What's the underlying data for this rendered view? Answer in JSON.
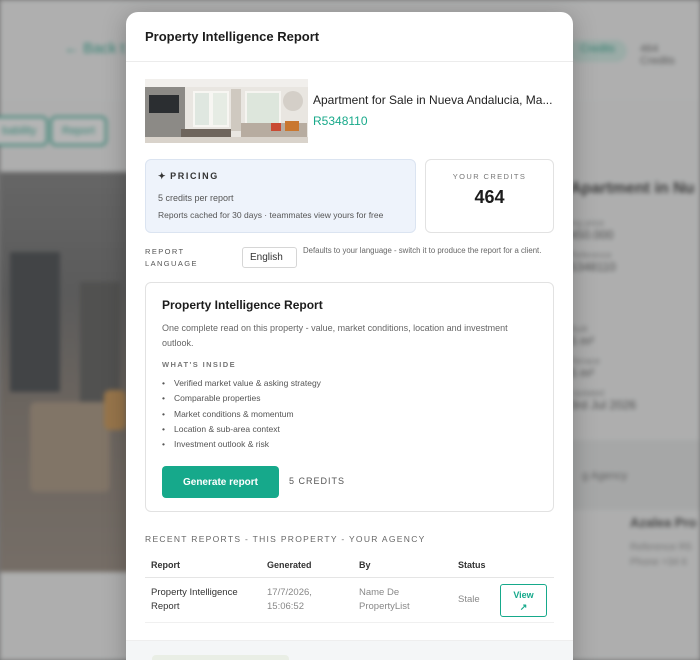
{
  "background": {
    "back_link": "← Back t",
    "credits_chip": "Credits",
    "credits_count": "464 Credits",
    "tab_a": "bability",
    "tab_b": "Report",
    "listing_title": "Apartment in Nu",
    "rows": [
      {
        "label": "ing price",
        "value": "450.000"
      },
      {
        "label": "Reference",
        "value": "5348110"
      },
      {
        "label": "Built",
        "value": "5 m²"
      },
      {
        "label": "Terrace",
        "value": "5 m²"
      },
      {
        "label": "Updated",
        "value": "3rd Jul 2026"
      }
    ],
    "agency_label": "g Agency",
    "agency_name": "Azalea Pro",
    "agency_ref": "Reference  R5",
    "agency_phone": "Phone  +34 6"
  },
  "modal": {
    "title": "Property Intelligence Report",
    "listing": {
      "title": "Apartment for Sale in Nueva Andalucia, Ma...",
      "reference": "R5348110"
    },
    "pricing": {
      "icon": "sparkle-icon",
      "heading": "PRICING",
      "line1": "5 credits per report",
      "line2": "Reports cached for 30 days · teammates view yours for free"
    },
    "credits": {
      "label": "YOUR CREDITS",
      "value": "464"
    },
    "language": {
      "label": "REPORT LANGUAGE",
      "selected": "English",
      "hint": "Defaults to your language - switch it to produce the report for a client."
    },
    "report": {
      "title": "Property Intelligence Report",
      "description": "One complete read on this property - value, market conditions, location and investment outlook.",
      "inside_label": "WHAT'S INSIDE",
      "items": [
        "Verified market value & asking strategy",
        "Comparable properties",
        "Market conditions & momentum",
        "Location & sub-area context",
        "Investment outlook & risk"
      ],
      "button": "Generate report",
      "cost": "5 CREDITS"
    },
    "recent": {
      "label": "RECENT REPORTS - THIS PROPERTY - YOUR AGENCY",
      "columns": [
        "Report",
        "Generated",
        "By",
        "Status"
      ],
      "rows": [
        {
          "report_l1": "Property Intelligence",
          "report_l2": "Report",
          "date": "17/7/2026,",
          "time": "15:06:52",
          "by_l1": "Name De",
          "by_l2": "PropertyList",
          "status": "Stale",
          "action": "View",
          "action_icon": "↗"
        }
      ]
    }
  },
  "colors": {
    "accent": "#16a98b",
    "pricing_bg": "#eef3fb"
  }
}
